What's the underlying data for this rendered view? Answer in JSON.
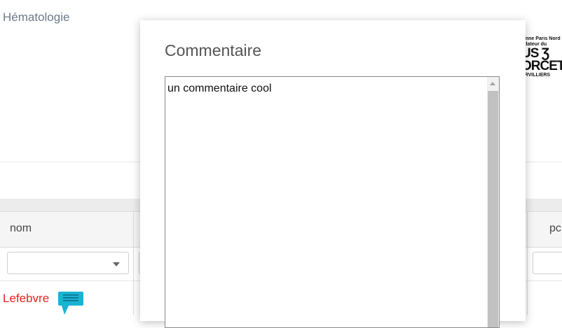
{
  "page": {
    "section_title": "Hématologie"
  },
  "logo": {
    "line1": "ienne Paris Nord",
    "line2": "ndateur du",
    "line3": "US Ʒ",
    "line4": "ORCET",
    "line5": "ERVILLIERS"
  },
  "grid": {
    "columns": [
      {
        "title": "nom"
      },
      {
        "title": "pc"
      }
    ],
    "filter_values": [
      "",
      ""
    ],
    "rows": [
      {
        "nom": "Lefebvre",
        "has_comment": true
      }
    ]
  },
  "modal": {
    "title": "Commentaire",
    "comment_value": "un commentaire cool"
  },
  "colors": {
    "accent": "#1ab3d4",
    "name_red": "#e0231e"
  },
  "icons": {
    "comment": "speech-bubble-icon",
    "dropdown": "caret-down-icon"
  }
}
